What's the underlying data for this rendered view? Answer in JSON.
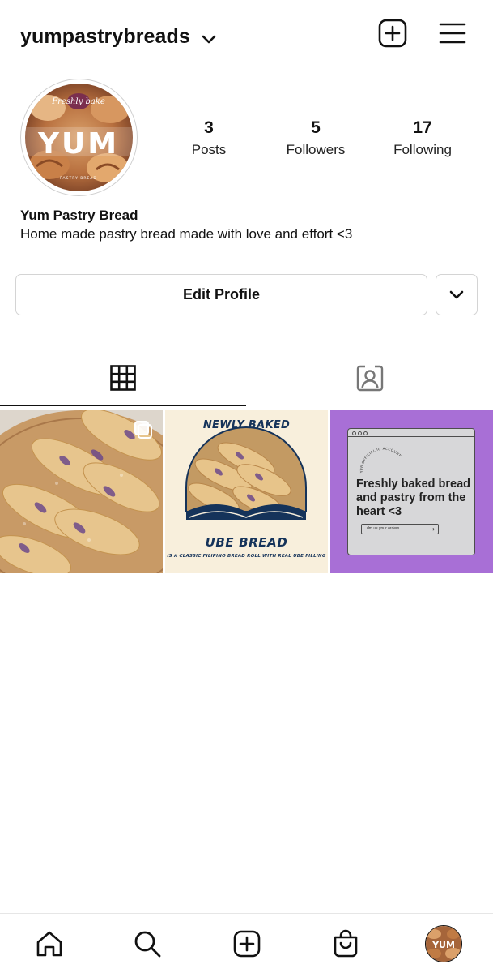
{
  "header": {
    "username": "yumpastrybreads",
    "icons": {
      "account_switch": "chevron-down-icon",
      "new_post": "plus-square-icon",
      "menu": "hamburger-menu-icon"
    }
  },
  "profile": {
    "avatar_text": {
      "tagline": "Freshly bake",
      "logo": "YUM",
      "bottom": "PASTRY BREAD"
    },
    "stats": {
      "posts": {
        "count": "3",
        "label": "Posts"
      },
      "followers": {
        "count": "5",
        "label": "Followers"
      },
      "following": {
        "count": "17",
        "label": "Following"
      }
    },
    "name": "Yum Pastry Bread",
    "bio": "Home made pastry bread made with love and effort <3"
  },
  "actions": {
    "edit_profile": "Edit Profile",
    "suggestions_icon": "chevron-down-icon"
  },
  "tabs": [
    {
      "icon": "grid-icon",
      "active": true
    },
    {
      "icon": "tagged-person-icon",
      "active": false
    }
  ],
  "posts": [
    {
      "kind": "photo",
      "multi": true
    },
    {
      "kind": "graphic",
      "top": "NEWLY BAKED",
      "title": "UBE BREAD",
      "subtitle": "IS A CLASSIC FILIPINO BREAD ROLL WITH REAL UBE FILLING"
    },
    {
      "kind": "graphic",
      "curved": "YPB OFFICIAL IG ACCOUNT",
      "headline": "Freshly baked bread and pastry from the heart <3",
      "cta": "dm us your orders",
      "background": "#a86fd6"
    }
  ],
  "bottom_nav": [
    {
      "icon": "home-icon"
    },
    {
      "icon": "search-icon"
    },
    {
      "icon": "create-icon"
    },
    {
      "icon": "shop-bag-icon"
    },
    {
      "icon": "profile-avatar",
      "text": "YUM"
    }
  ],
  "colors": {
    "active_tab": "#111111",
    "border": "#d4d4d4",
    "post3_bg": "#a86fd6",
    "ube_title": "#15335a"
  }
}
